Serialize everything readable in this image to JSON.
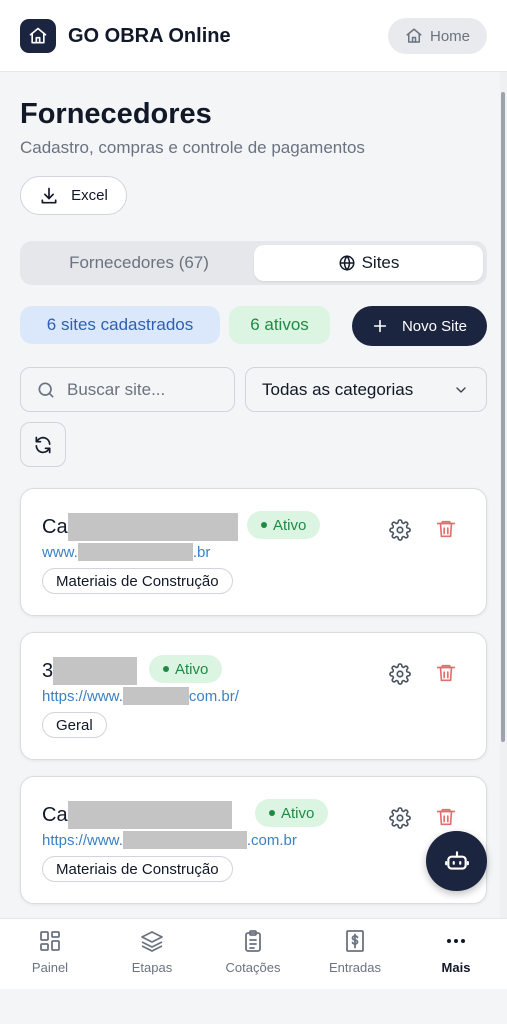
{
  "header": {
    "app_title": "GO OBRA Online",
    "home_label": "Home"
  },
  "page": {
    "title": "Fornecedores",
    "subtitle": "Cadastro, compras e controle de pagamentos",
    "excel_label": "Excel"
  },
  "tabs": [
    {
      "label": "Fornecedores (67)",
      "active": false
    },
    {
      "label": "Sites",
      "active": true
    }
  ],
  "summary": {
    "sites_count": "6 sites cadastrados",
    "active_count": "6 ativos",
    "new_site_label": "Novo Site"
  },
  "filters": {
    "search_placeholder": "Buscar site...",
    "category_selected": "Todas as categorias"
  },
  "sites": [
    {
      "name_prefix": "Ca",
      "status": "Ativo",
      "url_prefix": "www.",
      "url_suffix": ".br",
      "category": "Materiais de Construção"
    },
    {
      "name_prefix": "3",
      "status": "Ativo",
      "url_prefix": "https://www.",
      "url_suffix": "com.br/",
      "category": "Geral"
    },
    {
      "name_prefix": "Ca",
      "status": "Ativo",
      "url_prefix": "https://www.",
      "url_suffix": ".com.br",
      "category": "Materiais de Construção"
    }
  ],
  "bottom_nav": [
    {
      "label": "Painel",
      "icon": "grid-icon",
      "active": false
    },
    {
      "label": "Etapas",
      "icon": "layers-icon",
      "active": false
    },
    {
      "label": "Cotações",
      "icon": "clipboard-icon",
      "active": false
    },
    {
      "label": "Entradas",
      "icon": "receipt-dollar-icon",
      "active": false
    },
    {
      "label": "Mais",
      "icon": "more-dots-icon",
      "active": true
    }
  ],
  "colors": {
    "brand_dark": "#1c2540",
    "active_green": "#1f8a44",
    "link_blue": "#3b82c4",
    "delete_red": "#e26d6d"
  }
}
